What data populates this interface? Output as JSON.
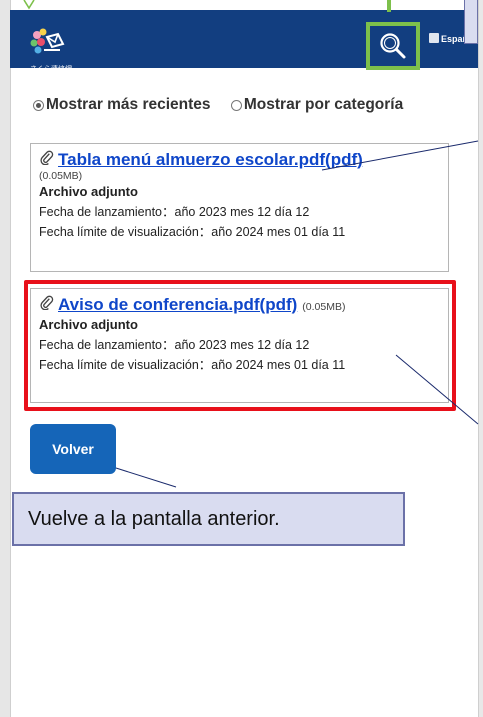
{
  "header": {
    "logo_text": "さくら連絡網",
    "language_label": "Españ"
  },
  "view_options": {
    "recent_label": "Mostrar más recientes",
    "category_label": "Mostrar por categoría",
    "selected": "recent"
  },
  "attachments": [
    {
      "title": "Tabla menú almuerzo escolar.pdf(pdf)",
      "size": "(0.05MB)",
      "type_label": "Archivo adjunto",
      "release": "Fecha de lanzamiento：año 2023 mes 12 día 12",
      "deadline": "Fecha límite de visualización：año 2024 mes 01 día 11"
    },
    {
      "title": "Aviso de conferencia.pdf(pdf)",
      "size": "(0.05MB)",
      "type_label": "Archivo adjunto",
      "release": "Fecha de lanzamiento：año 2023 mes 12 día 12",
      "deadline": "Fecha límite de visualización：año 2024 mes 01 día 11"
    }
  ],
  "back_button": {
    "label": "Volver"
  },
  "callout": {
    "text": "Vuelve a la pantalla anterior."
  },
  "colors": {
    "header": "#123e80",
    "highlight": "#e8101a",
    "search_highlight": "#7dc04b",
    "button": "#1565b8",
    "link": "#0f46c9"
  }
}
